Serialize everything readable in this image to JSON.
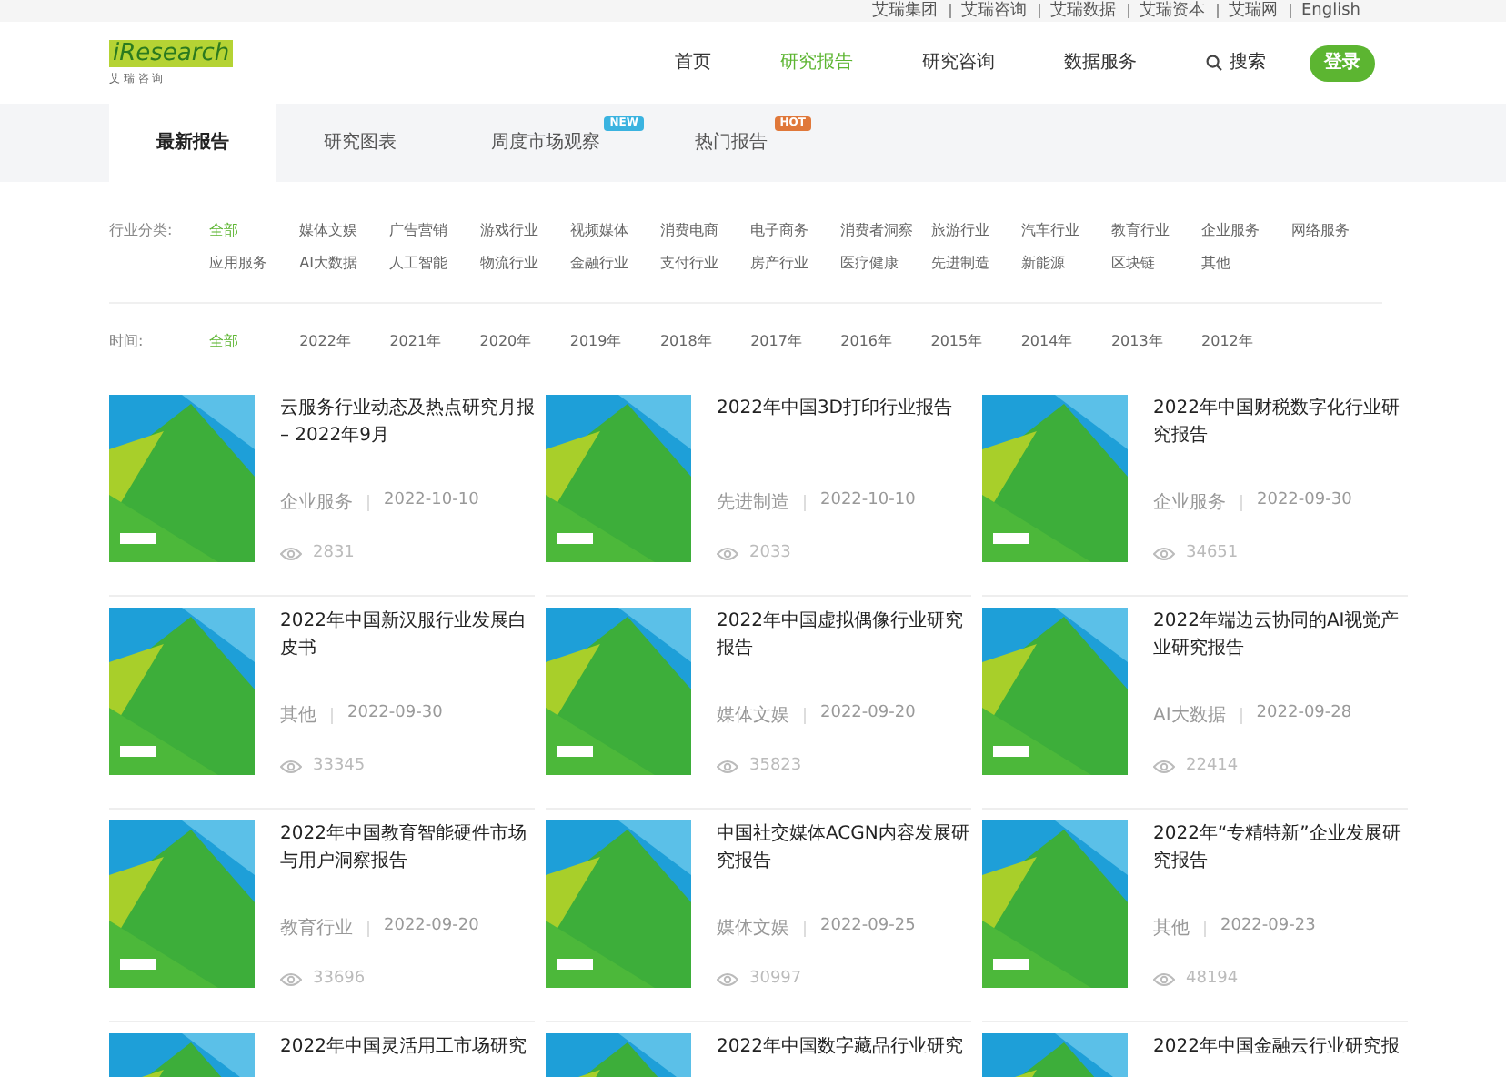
{
  "top_links": [
    "艾瑞集团",
    "艾瑞咨询",
    "艾瑞数据",
    "艾瑞资本",
    "艾瑞网",
    "English"
  ],
  "logo": {
    "name": "iResearch",
    "subtitle": "艾 瑞 咨 询"
  },
  "nav": [
    {
      "label": "首页",
      "selected": false
    },
    {
      "label": "研究报告",
      "selected": true
    },
    {
      "label": "研究咨询",
      "selected": false
    },
    {
      "label": "数据服务",
      "selected": false
    }
  ],
  "search": {
    "label": "搜索"
  },
  "login_button": "登录",
  "tabs": [
    {
      "label": "最新报告",
      "selected": true
    },
    {
      "label": "研究图表",
      "selected": false
    },
    {
      "label": "周度市场观察",
      "selected": false,
      "badge": "NEW",
      "color": "#3ab3e0"
    },
    {
      "label": "热门报告",
      "selected": false,
      "badge": "HOT",
      "color": "#e0783a"
    }
  ],
  "filters": [
    {
      "label": "行业分类:",
      "options": [
        {
          "label": "全部",
          "selected": true
        },
        {
          "label": "媒体文娱",
          "selected": false
        },
        {
          "label": "广告营销",
          "selected": false
        },
        {
          "label": "游戏行业",
          "selected": false
        },
        {
          "label": "视频媒体",
          "selected": false
        },
        {
          "label": "消费电商",
          "selected": false
        },
        {
          "label": "电子商务",
          "selected": false
        },
        {
          "label": "消费者洞察",
          "selected": false
        },
        {
          "label": "旅游行业",
          "selected": false
        },
        {
          "label": "汽车行业",
          "selected": false
        },
        {
          "label": "教育行业",
          "selected": false
        },
        {
          "label": "企业服务",
          "selected": false
        },
        {
          "label": "网络服务",
          "selected": false
        },
        {
          "label": "应用服务",
          "selected": false
        },
        {
          "label": "AI大数据",
          "selected": false
        },
        {
          "label": "人工智能",
          "selected": false
        },
        {
          "label": "物流行业",
          "selected": false
        },
        {
          "label": "金融行业",
          "selected": false
        },
        {
          "label": "支付行业",
          "selected": false
        },
        {
          "label": "房产行业",
          "selected": false
        },
        {
          "label": "医疗健康",
          "selected": false
        },
        {
          "label": "先进制造",
          "selected": false
        },
        {
          "label": "新能源",
          "selected": false
        },
        {
          "label": "区块链",
          "selected": false
        },
        {
          "label": "其他",
          "selected": false
        }
      ]
    },
    {
      "label": "时间:",
      "options": [
        {
          "label": "全部",
          "selected": true
        },
        {
          "label": "2022年",
          "selected": false
        },
        {
          "label": "2021年",
          "selected": false
        },
        {
          "label": "2020年",
          "selected": false
        },
        {
          "label": "2019年",
          "selected": false
        },
        {
          "label": "2018年",
          "selected": false
        },
        {
          "label": "2017年",
          "selected": false
        },
        {
          "label": "2016年",
          "selected": false
        },
        {
          "label": "2015年",
          "selected": false
        },
        {
          "label": "2014年",
          "selected": false
        },
        {
          "label": "2013年",
          "selected": false
        },
        {
          "label": "2012年",
          "selected": false
        }
      ]
    }
  ],
  "reports": [
    {
      "title": "云服务行业动态及热点研究月报 – 2022年9月",
      "category": "企业服务",
      "date": "2022-10-10",
      "views": "2831"
    },
    {
      "title": "2022年中国3D打印行业报告",
      "category": "先进制造",
      "date": "2022-10-10",
      "views": "2033"
    },
    {
      "title": "2022年中国财税数字化行业研究报告",
      "category": "企业服务",
      "date": "2022-09-30",
      "views": "34651"
    },
    {
      "title": "2022年中国新汉服行业发展白皮书",
      "category": "其他",
      "date": "2022-09-30",
      "views": "33345"
    },
    {
      "title": "2022年中国虚拟偶像行业研究报告",
      "category": "媒体文娱",
      "date": "2022-09-20",
      "views": "35823"
    },
    {
      "title": "2022年端边云协同的AI视觉产业研究报告",
      "category": "AI大数据",
      "date": "2022-09-28",
      "views": "22414"
    },
    {
      "title": "2022年中国教育智能硬件市场与用户洞察报告",
      "category": "教育行业",
      "date": "2022-09-20",
      "views": "33696"
    },
    {
      "title": "中国社交媒体ACGN内容发展研究报告",
      "category": "媒体文娱",
      "date": "2022-09-25",
      "views": "30997"
    },
    {
      "title": "2022年“专精特新”企业发展研究报告",
      "category": "其他",
      "date": "2022-09-23",
      "views": "48194"
    },
    {
      "title": "2022年中国灵活用工市场研究"
    },
    {
      "title": "2022年中国数字藏品行业研究"
    },
    {
      "title": "2022年中国金融云行业研究报"
    }
  ]
}
